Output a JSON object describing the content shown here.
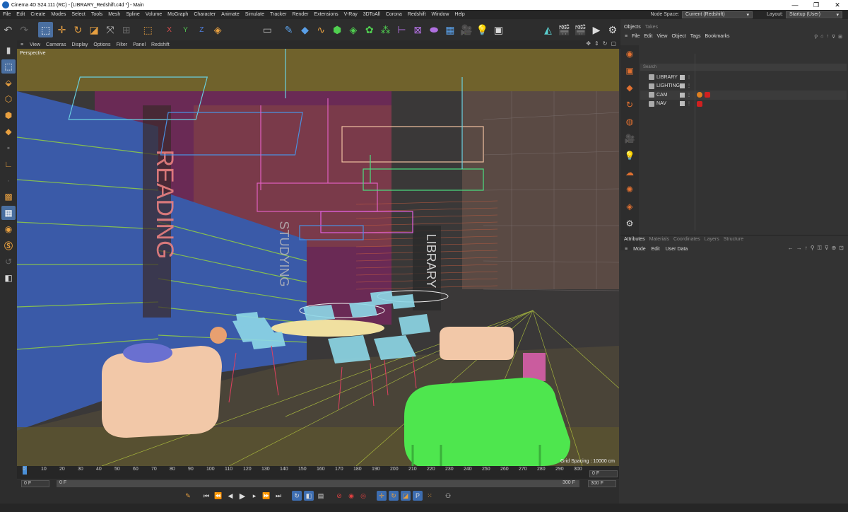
{
  "window": {
    "title": "Cinema 4D S24.111 (RC) - [LIBRARY_Redshift.c4d *] - Main",
    "controls": [
      "—",
      "❐",
      "✕"
    ]
  },
  "menubar": {
    "items": [
      "File",
      "Edit",
      "Create",
      "Modes",
      "Select",
      "Tools",
      "Mesh",
      "Spline",
      "Volume",
      "MoGraph",
      "Character",
      "Animate",
      "Simulate",
      "Tracker",
      "Render",
      "Extensions",
      "V-Ray",
      "3DToAll",
      "Corona",
      "Redshift",
      "Window",
      "Help"
    ],
    "node_space_label": "Node Space:",
    "node_space_value": "Current (Redshift)",
    "layout_label": "Layout:",
    "layout_value": "Startup (User)"
  },
  "viewport": {
    "menu": [
      "View",
      "Cameras",
      "Display",
      "Options",
      "Filter",
      "Panel",
      "Redshift"
    ],
    "view_name": "Perspective",
    "grid_spacing": "Grid Spacing : 10000 cm"
  },
  "timeline": {
    "ticks": [
      "0",
      "10",
      "20",
      "30",
      "40",
      "50",
      "60",
      "70",
      "80",
      "90",
      "100",
      "110",
      "120",
      "130",
      "140",
      "150",
      "160",
      "170",
      "180",
      "190",
      "200",
      "210",
      "220",
      "230",
      "240",
      "250",
      "260",
      "270",
      "280",
      "290",
      "300"
    ],
    "current_frame": "0 F",
    "start": "0 F",
    "start_b": "0 F",
    "end": "300 F",
    "end_b": "300 F"
  },
  "objects_panel": {
    "tabs": [
      "Objects",
      "Takes"
    ],
    "menu": [
      "File",
      "Edit",
      "View",
      "Object",
      "Tags",
      "Bookmarks"
    ],
    "search_placeholder": "Search",
    "items": [
      {
        "name": "LIBRARY"
      },
      {
        "name": "LIGHTING"
      },
      {
        "name": "CAM"
      },
      {
        "name": "NAV"
      }
    ]
  },
  "attributes_panel": {
    "tabs": [
      "Attributes",
      "Materials",
      "Coordinates",
      "Layers",
      "Structure"
    ],
    "menu": [
      "Mode",
      "Edit",
      "User Data"
    ]
  },
  "colors": {
    "accent": "#4a6fa0",
    "bg": "#333333",
    "wire_green": "#4ee64e",
    "wire_pink": "#f0c8a8"
  }
}
